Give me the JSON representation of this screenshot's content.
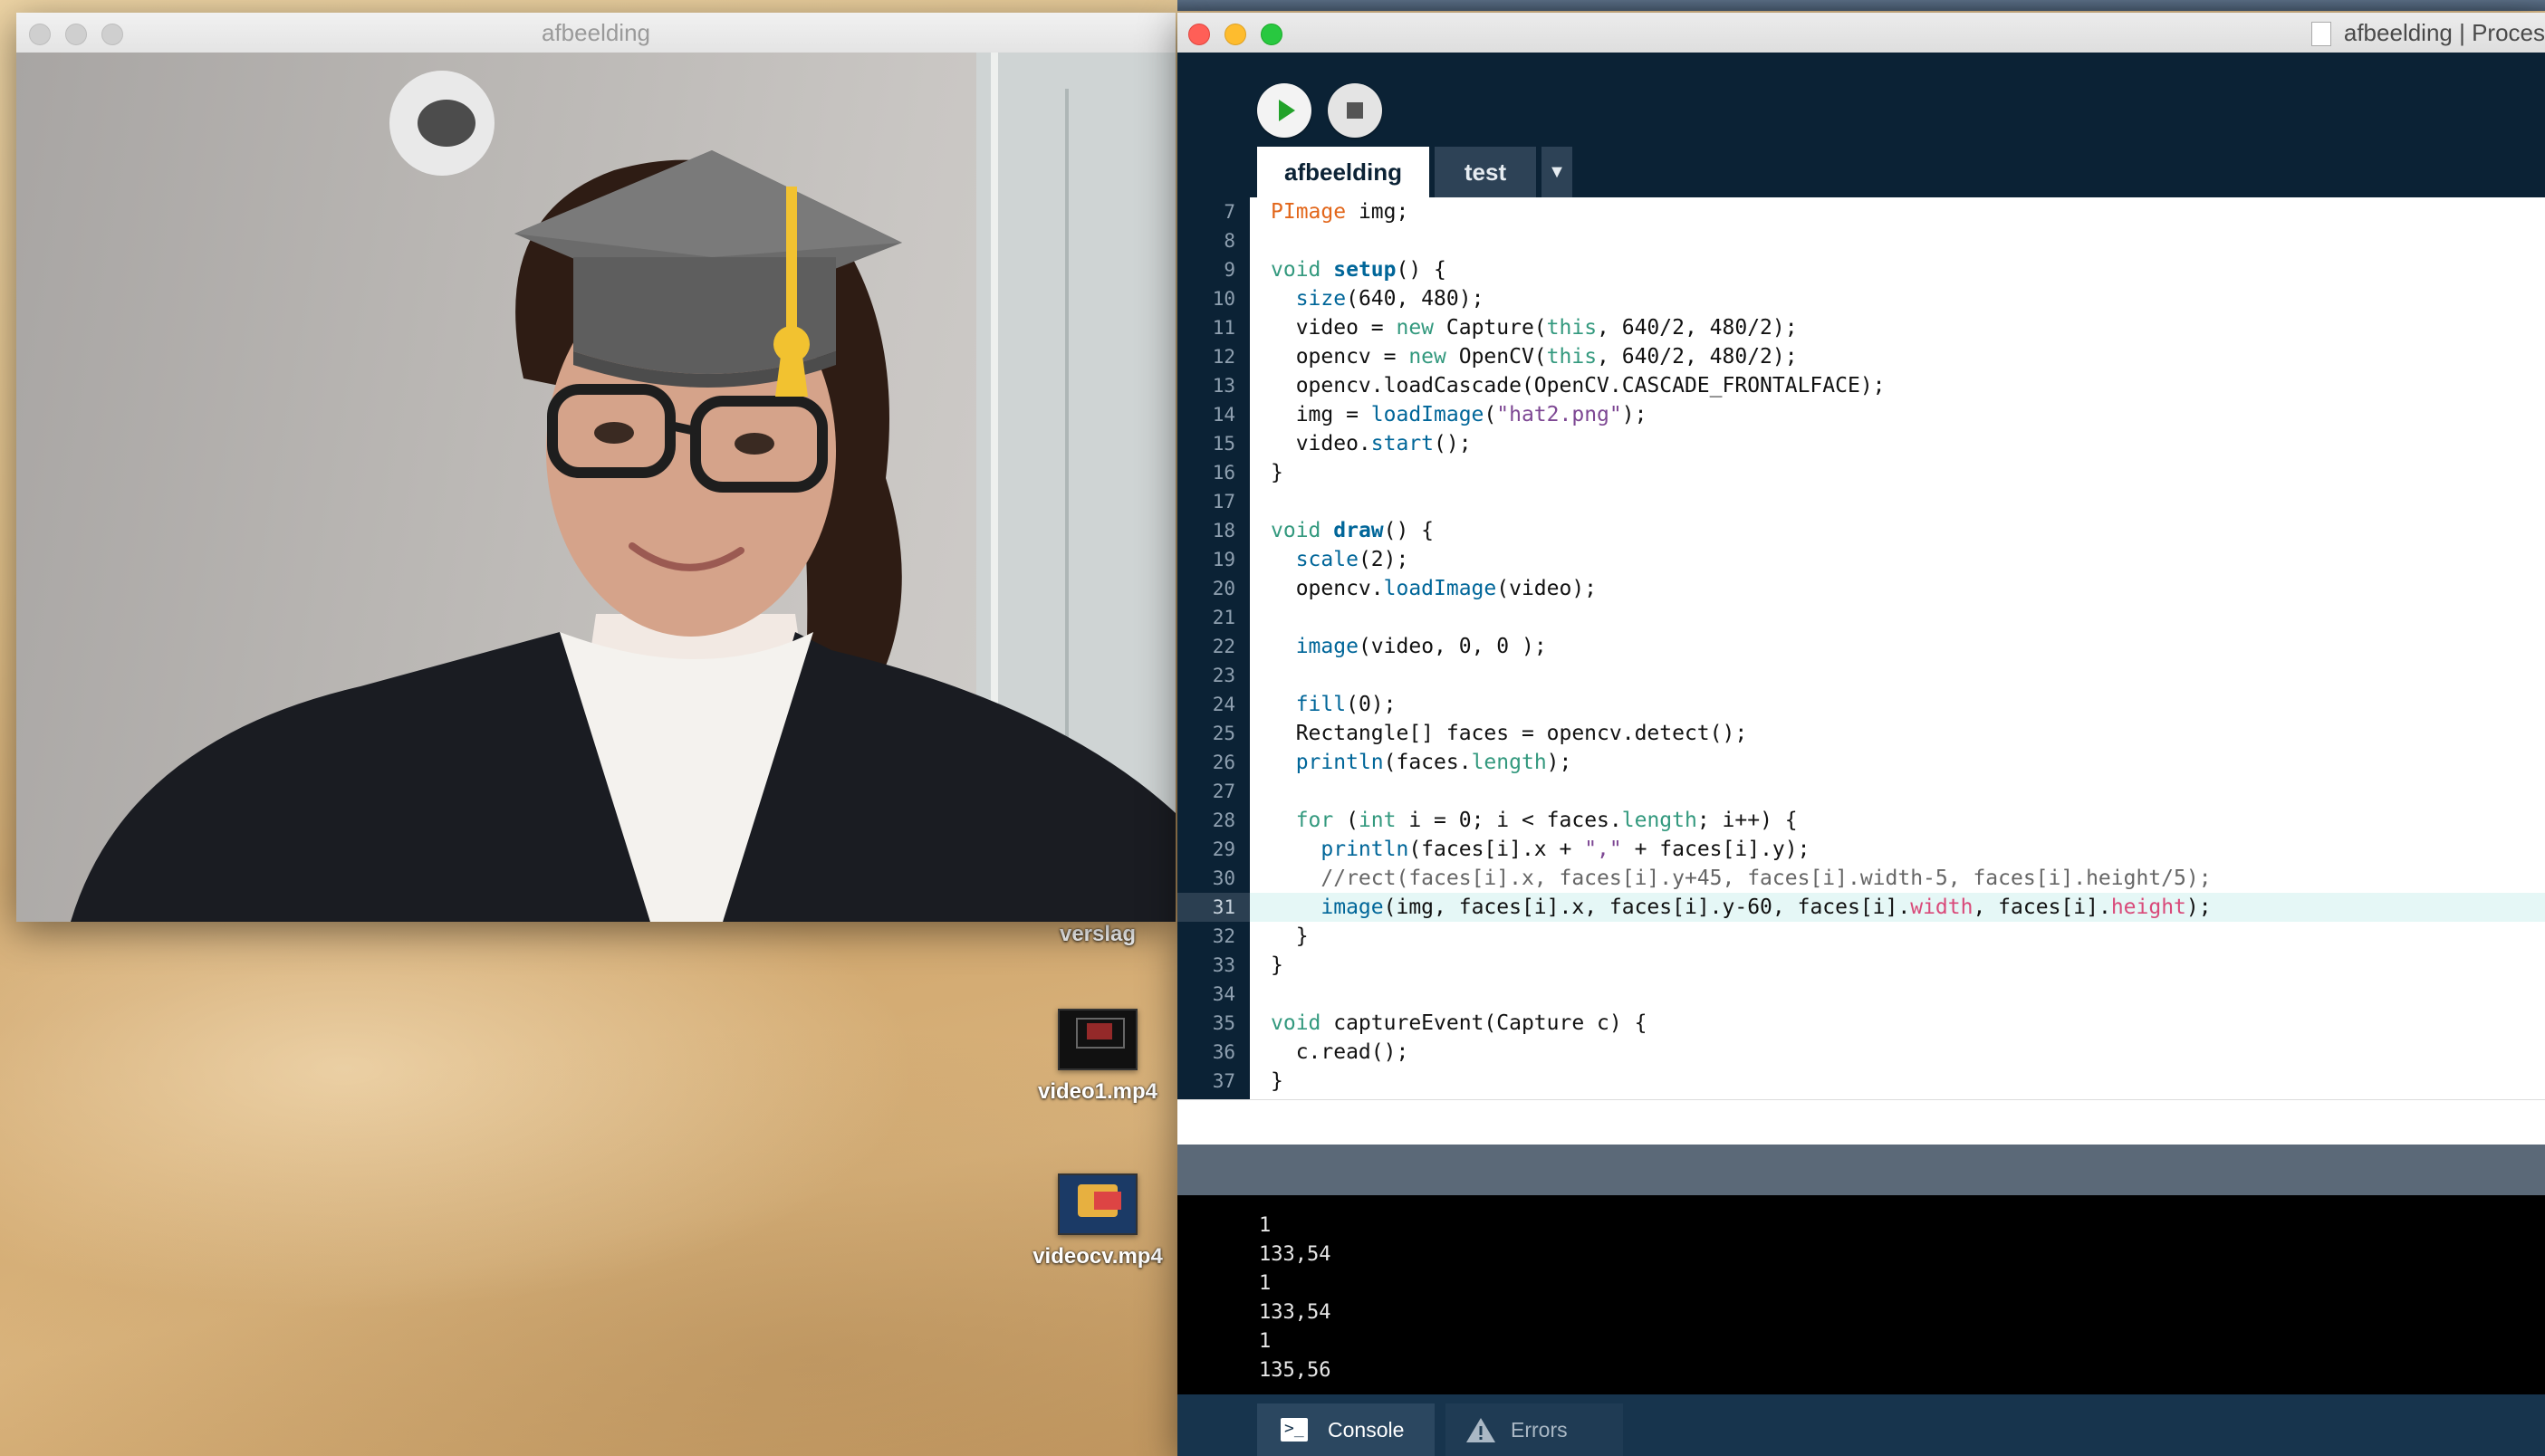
{
  "sketch_window": {
    "title": "afbeelding"
  },
  "desktop": {
    "icons": [
      {
        "label": "verslag"
      },
      {
        "label": "video1.mp4"
      },
      {
        "label": "videocv.mp4"
      }
    ]
  },
  "ide": {
    "title": "afbeelding | Proces",
    "tabs": [
      {
        "label": "afbeelding"
      },
      {
        "label": "test"
      }
    ],
    "tab_menu_glyph": "▼",
    "code_lines": [
      {
        "n": "7"
      },
      {
        "n": "8"
      },
      {
        "n": "9"
      },
      {
        "n": "10"
      },
      {
        "n": "11"
      },
      {
        "n": "12"
      },
      {
        "n": "13"
      },
      {
        "n": "14"
      },
      {
        "n": "15"
      },
      {
        "n": "16"
      },
      {
        "n": "17"
      },
      {
        "n": "18"
      },
      {
        "n": "19"
      },
      {
        "n": "20"
      },
      {
        "n": "21"
      },
      {
        "n": "22"
      },
      {
        "n": "23"
      },
      {
        "n": "24"
      },
      {
        "n": "25"
      },
      {
        "n": "26"
      },
      {
        "n": "27"
      },
      {
        "n": "28"
      },
      {
        "n": "29"
      },
      {
        "n": "30"
      },
      {
        "n": "31"
      },
      {
        "n": "32"
      },
      {
        "n": "33"
      },
      {
        "n": "34"
      },
      {
        "n": "35"
      },
      {
        "n": "36"
      },
      {
        "n": "37"
      }
    ],
    "code": [
      [
        {
          "c": "t-type",
          "t": "PImage"
        },
        {
          "t": " img;"
        }
      ],
      [],
      [
        {
          "c": "t-kw",
          "t": "void"
        },
        {
          "t": " "
        },
        {
          "c": "t-fn",
          "t": "setup"
        },
        {
          "t": "() {"
        }
      ],
      [
        {
          "t": "  "
        },
        {
          "c": "t-call",
          "t": "size"
        },
        {
          "t": "(640, 480);"
        }
      ],
      [
        {
          "t": "  video = "
        },
        {
          "c": "t-kw",
          "t": "new"
        },
        {
          "t": " Capture("
        },
        {
          "c": "t-kw",
          "t": "this"
        },
        {
          "t": ", 640/2, 480/2);"
        }
      ],
      [
        {
          "t": "  opencv = "
        },
        {
          "c": "t-kw",
          "t": "new"
        },
        {
          "t": " OpenCV("
        },
        {
          "c": "t-kw",
          "t": "this"
        },
        {
          "t": ", 640/2, 480/2);"
        }
      ],
      [
        {
          "t": "  opencv.loadCascade(OpenCV.CASCADE_FRONTALFACE);"
        }
      ],
      [
        {
          "t": "  img = "
        },
        {
          "c": "t-call",
          "t": "loadImage"
        },
        {
          "t": "("
        },
        {
          "c": "t-str",
          "t": "\"hat2.png\""
        },
        {
          "t": ");"
        }
      ],
      [
        {
          "t": "  video."
        },
        {
          "c": "t-call",
          "t": "start"
        },
        {
          "t": "();"
        }
      ],
      [
        {
          "t": "}"
        }
      ],
      [],
      [
        {
          "c": "t-kw",
          "t": "void"
        },
        {
          "t": " "
        },
        {
          "c": "t-fn",
          "t": "draw"
        },
        {
          "t": "() {"
        }
      ],
      [
        {
          "t": "  "
        },
        {
          "c": "t-call",
          "t": "scale"
        },
        {
          "t": "(2);"
        }
      ],
      [
        {
          "t": "  opencv."
        },
        {
          "c": "t-call",
          "t": "loadImage"
        },
        {
          "t": "(video);"
        }
      ],
      [],
      [
        {
          "t": "  "
        },
        {
          "c": "t-call",
          "t": "image"
        },
        {
          "t": "(video, 0, 0 );"
        }
      ],
      [],
      [
        {
          "t": "  "
        },
        {
          "c": "t-call",
          "t": "fill"
        },
        {
          "t": "(0);"
        }
      ],
      [
        {
          "t": "  Rectangle[] faces = opencv.detect();"
        }
      ],
      [
        {
          "t": "  "
        },
        {
          "c": "t-call",
          "t": "println"
        },
        {
          "t": "(faces."
        },
        {
          "c": "t-kw",
          "t": "length"
        },
        {
          "t": ");"
        }
      ],
      [],
      [
        {
          "t": "  "
        },
        {
          "c": "t-kw",
          "t": "for"
        },
        {
          "t": " ("
        },
        {
          "c": "t-kw",
          "t": "int"
        },
        {
          "t": " i = 0; i < faces."
        },
        {
          "c": "t-kw",
          "t": "length"
        },
        {
          "t": "; i++) {"
        }
      ],
      [
        {
          "t": "    "
        },
        {
          "c": "t-call",
          "t": "println"
        },
        {
          "t": "(faces[i].x + "
        },
        {
          "c": "t-str",
          "t": "\",\""
        },
        {
          "t": " + faces[i].y);"
        }
      ],
      [
        {
          "c": "t-cmt",
          "t": "    //rect(faces[i].x, faces[i].y+45, faces[i].width-5, faces[i].height/5);"
        }
      ],
      [
        {
          "t": "    "
        },
        {
          "c": "t-call",
          "t": "image"
        },
        {
          "t": "(img, faces[i].x, faces[i].y-60, faces[i]."
        },
        {
          "c": "t-prop",
          "t": "width"
        },
        {
          "t": ", faces[i]."
        },
        {
          "c": "t-prop",
          "t": "height"
        },
        {
          "t": ");"
        }
      ],
      [
        {
          "t": "  }"
        }
      ],
      [
        {
          "t": "}"
        }
      ],
      [],
      [
        {
          "c": "t-kw",
          "t": "void"
        },
        {
          "t": " captureEvent(Capture c) {"
        }
      ],
      [
        {
          "t": "  c.read();"
        }
      ],
      [
        {
          "t": "}"
        }
      ]
    ],
    "highlighted_line": "31",
    "console_lines": [
      "1",
      "133,54",
      "1",
      "133,54",
      "1",
      "135,56"
    ],
    "console_tabs": [
      {
        "label": "Console"
      },
      {
        "label": "Errors"
      }
    ]
  }
}
